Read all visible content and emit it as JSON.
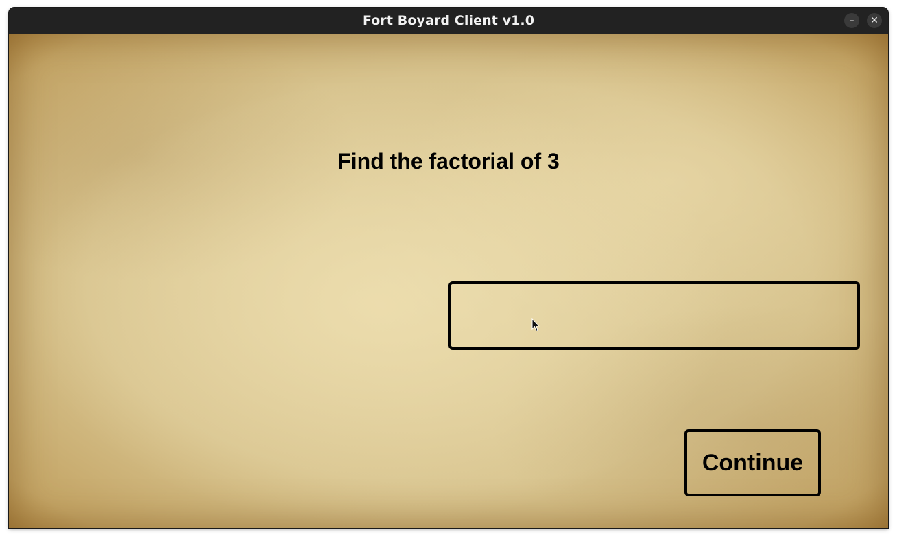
{
  "window": {
    "title": "Fort Boyard Client v1.0",
    "minimize_glyph": "–",
    "close_glyph": "✕"
  },
  "game": {
    "question": "Find the factorial of 3",
    "answer_value": "",
    "answer_placeholder": "",
    "continue_label": "Continue"
  },
  "colors": {
    "titlebar": "#222222",
    "parchment": "#d8c48f",
    "text": "#000000"
  },
  "icons": [
    "minimize-icon",
    "close-icon",
    "mouse-pointer-icon"
  ]
}
